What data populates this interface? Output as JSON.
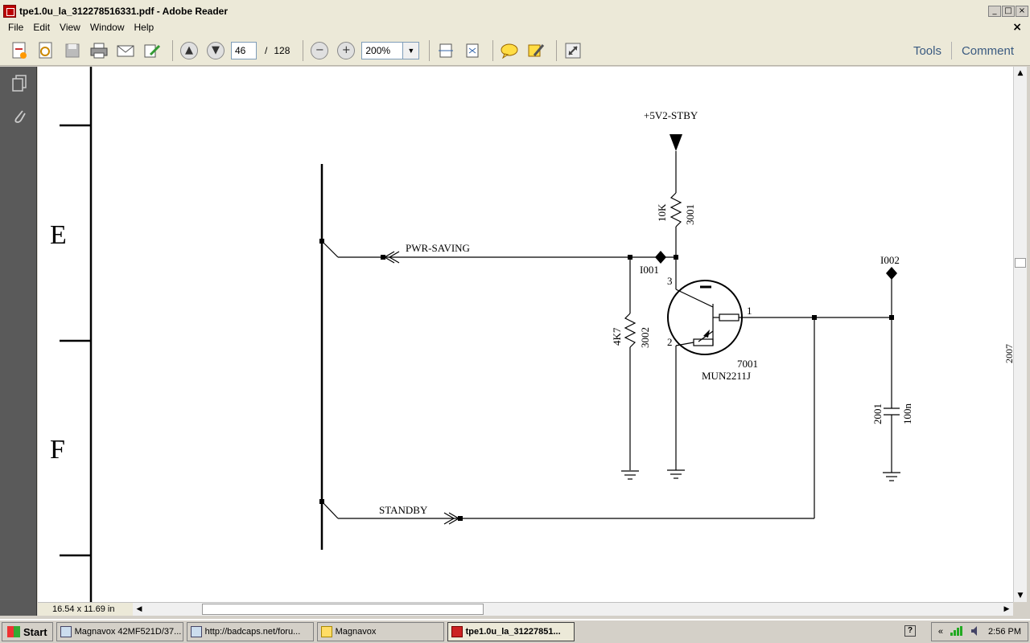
{
  "window": {
    "title": "tpe1.0u_la_312278516331.pdf - Adobe Reader",
    "min": "_",
    "max": "□",
    "close": "×"
  },
  "menu": {
    "items": [
      "File",
      "Edit",
      "View",
      "Window",
      "Help"
    ],
    "close_doc": "×"
  },
  "toolbar": {
    "page_current": "46",
    "page_sep": "/",
    "page_total": "128",
    "zoom": "200%",
    "tools_label": "Tools",
    "comment_label": "Comment"
  },
  "schematic": {
    "row_e": "E",
    "row_f": "F",
    "supply_label": "+5V2-STBY",
    "r3001_value": "10K",
    "r3001_ref": "3001",
    "pwr_saving_label": "PWR-SAVING",
    "i001_label": "I001",
    "i002_label": "I002",
    "pin3": "3",
    "pin2": "2",
    "pin1": "1",
    "r3002_value": "4K7",
    "r3002_ref": "3002",
    "transistor_ref": "7001",
    "transistor_part": "MUN2211J",
    "cap_ref": "2001",
    "cap_value": "100n",
    "standby_label": "STANDBY",
    "edge_label": "2007"
  },
  "status": {
    "page_size": "16.54 x 11.69 in"
  },
  "taskbar": {
    "start": "Start",
    "tasks": [
      {
        "label": "Magnavox 42MF521D/37..."
      },
      {
        "label": "http://badcaps.net/foru..."
      },
      {
        "label": "Magnavox"
      },
      {
        "label": "tpe1.0u_la_31227851..."
      }
    ],
    "help": "?",
    "chevron": "«",
    "clock": "2:56 PM"
  }
}
